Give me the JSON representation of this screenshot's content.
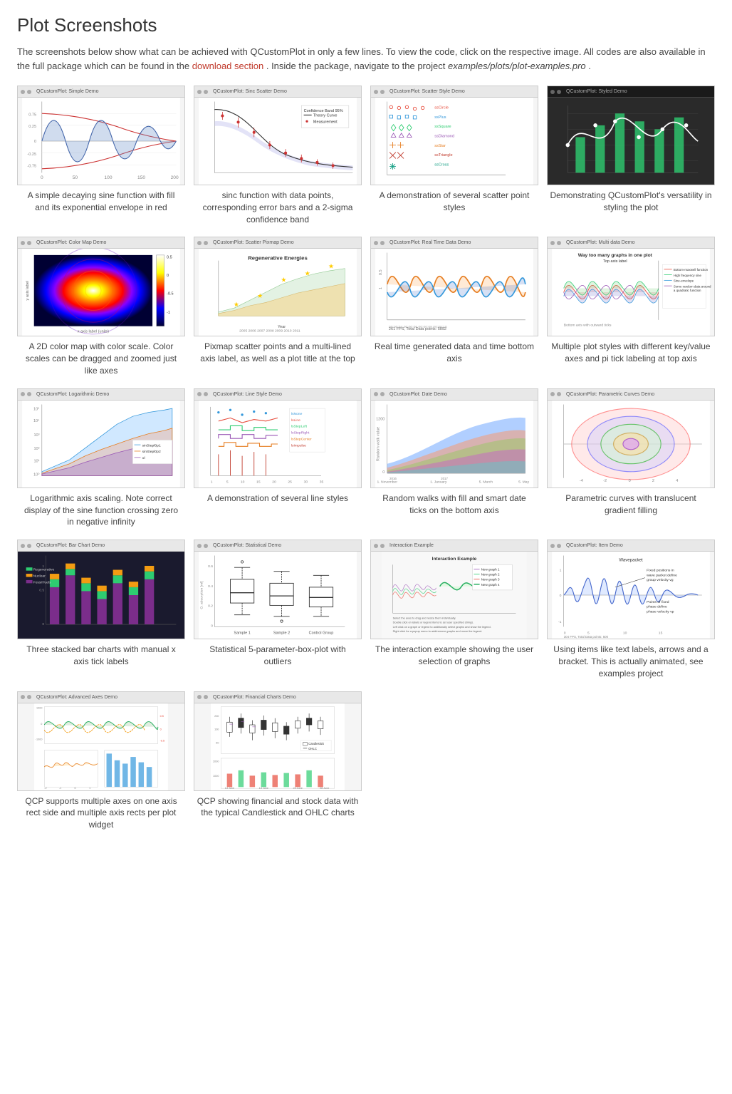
{
  "page": {
    "title": "Plot Screenshots",
    "intro_text": "The screenshots below show what can be achieved with QCustomPlot in only a few lines. To view the code, click on the respective image. All codes are also available in the full package which can be found in the",
    "intro_link": "download section",
    "intro_text2": ". Inside the package, navigate to the project",
    "intro_path": "examples/plots/plot-examples.pro",
    "intro_period": "."
  },
  "plots": [
    {
      "id": "simple-demo",
      "title": "QCustomPlot: Simple Demo",
      "caption": "A simple decaying sine function with fill and its exponential envelope in red",
      "caption_highlight": "",
      "type": "sine"
    },
    {
      "id": "sinc-scatter",
      "title": "QCustomPlot: Sinc Scatter Demo",
      "caption": "sinc function with data points, corresponding error bars and a 2-sigma confidence band",
      "type": "sinc"
    },
    {
      "id": "scatter-style",
      "title": "QCustomPlot: Scatter Style Demo",
      "caption": "A demonstration of several scatter point styles",
      "type": "scatter-style"
    },
    {
      "id": "styled-demo",
      "title": "QCustomPlot: Styled Demo",
      "caption": "Demonstrating QCustomPlot's versatility in styling the plot",
      "type": "styled"
    },
    {
      "id": "colormap",
      "title": "QCustomPlot: Color Map Demo",
      "caption": "A 2D color map with color scale. Color scales can be dragged and zoomed just like axes",
      "type": "colormap"
    },
    {
      "id": "scatter-pixmap",
      "title": "QCustomPlot: Scatter Pixmap Demo",
      "caption": "Pixmap scatter points and a multi-lined axis label, as well as a plot title at the top",
      "type": "scatter-pixmap"
    },
    {
      "id": "realtime",
      "title": "QCustomPlot: Real Time Data Demo",
      "caption": "Real time generated data and time bottom axis",
      "type": "realtime"
    },
    {
      "id": "multidata",
      "title": "QCustomPlot: Multi data Demo",
      "caption": "Multiple plot styles with different key/value axes and pi tick labeling at top axis",
      "type": "multidata"
    },
    {
      "id": "logarithmic",
      "title": "QCustomPlot: Logarithmic Demo",
      "caption": "Logarithmic axis scaling. Note correct display of the sine function crossing zero in negative infinity",
      "type": "logarithmic"
    },
    {
      "id": "linestyle",
      "title": "QCustomPlot: Line Style Demo",
      "caption": "A demonstration of several line styles",
      "type": "linestyle"
    },
    {
      "id": "date",
      "title": "QCustomPlot: Date Demo",
      "caption": "Random walks with fill and smart date ticks on the bottom axis",
      "type": "date"
    },
    {
      "id": "parametric",
      "title": "QCustomPlot: Parametric Curves Demo",
      "caption": "Parametric curves with translucent gradient filling",
      "type": "parametric"
    },
    {
      "id": "barchart",
      "title": "QCustomPlot: Bar Chart Demo",
      "caption": "Three stacked bar charts with manual x axis tick labels",
      "type": "barchart"
    },
    {
      "id": "statistical",
      "title": "QCustomPlot: Statistical Demo",
      "caption": "Statistical 5-parameter-box-plot with outliers",
      "type": "statistical"
    },
    {
      "id": "interaction",
      "title": "Interaction Example",
      "caption": "The interaction example showing the user selection of graphs",
      "type": "interaction"
    },
    {
      "id": "item",
      "title": "QCustomPlot: Item Demo",
      "caption": "Using items like text labels, arrows and a bracket. This is actually animated, see examples project",
      "type": "item"
    },
    {
      "id": "advanced-axes",
      "title": "QCustomPlot: Advanced Axes Demo",
      "caption": "QCP supports multiple axes on one axis rect side and multiple axis rects per plot widget",
      "type": "advanced-axes"
    },
    {
      "id": "financial",
      "title": "QCustomPlot: Financial Charts Demo",
      "caption": "QCP showing financial and stock data with the typical Candlestick and OHLC charts",
      "type": "financial"
    }
  ]
}
